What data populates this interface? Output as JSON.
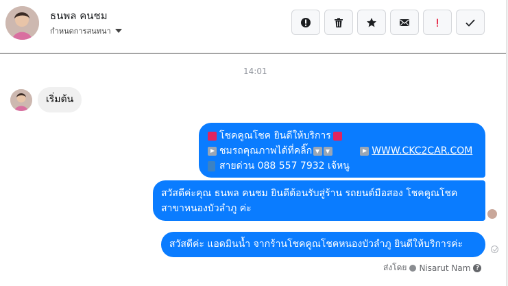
{
  "header": {
    "contact_name": "ธนพล คนชม",
    "assign_label": "กำหนดการสนทนา"
  },
  "toolbar": {
    "buttons": [
      {
        "icon": "alert-circle-icon"
      },
      {
        "icon": "trash-icon"
      },
      {
        "icon": "star-icon"
      },
      {
        "icon": "envelope-icon"
      },
      {
        "icon": "exclamation-icon",
        "color": "#e41e3f"
      },
      {
        "icon": "checkmark-icon"
      }
    ]
  },
  "conversation": {
    "timestamp": "14:01",
    "incoming": {
      "text": "เริ่มต้น"
    },
    "outgoing": [
      {
        "line1": "โชคคูณโชค ยินดีให้บริการ",
        "line2": "ชมรถคุณภาพได้ที่คลิ๊ก",
        "link": "WWW.CKC2CAR.COM",
        "line3": "สายด่วน 088 557 7932 เจ้หนู"
      },
      {
        "line1": "สวัสดีค่ะคุณ ธนพล คนชม ยินดีต้อนรับสู่ร้าน รถยนต์มือสอง โชคคูณโชค",
        "line2": "สาขาหนองบัวลำภู ค่ะ"
      },
      {
        "text": "สวัสดีค่ะ แอดมินน้ำ จากร้านโชคคูณโชคหนองบัวลำภู ยินดีให้บริการค่ะ"
      }
    ],
    "sent_by_label": "ส่งโดย",
    "sent_by_name": "Nisarut Nam"
  },
  "colors": {
    "bubble_out": "#0a7cff",
    "bubble_in": "#f0f0f0"
  }
}
